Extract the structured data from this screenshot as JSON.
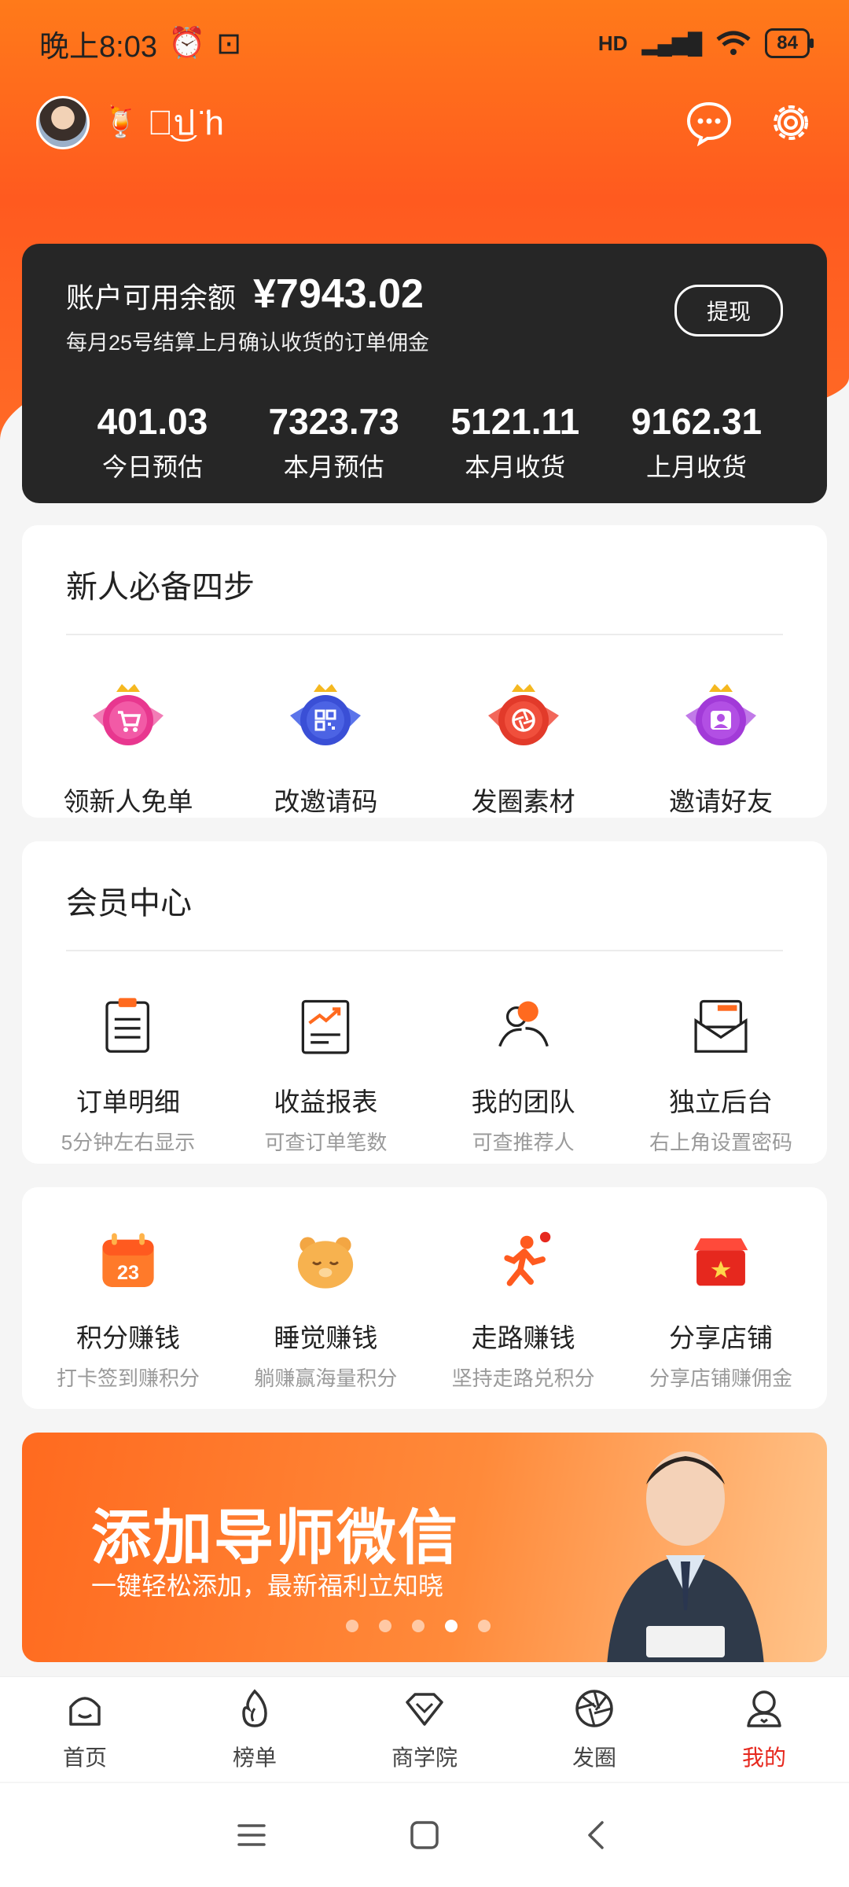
{
  "status": {
    "time": "晚上8:03",
    "network": "HD",
    "battery": "84"
  },
  "profile": {
    "name": "ป͜ป ̈h",
    "drink_emoji": "🍹"
  },
  "balance": {
    "label": "账户可用余额",
    "amount": "¥7943.02",
    "note": "每月25号结算上月确认收货的订单佣金",
    "withdraw_label": "提现",
    "stats": [
      {
        "value": "401.03",
        "label": "今日预估"
      },
      {
        "value": "7323.73",
        "label": "本月预估"
      },
      {
        "value": "5121.11",
        "label": "本月收货"
      },
      {
        "value": "9162.31",
        "label": "上月收货"
      }
    ]
  },
  "newbie": {
    "title": "新人必备四步",
    "items": [
      {
        "label": "领新人免单",
        "icon": "cart-badge-icon",
        "color": "#e8378f"
      },
      {
        "label": "改邀请码",
        "icon": "qrcode-badge-icon",
        "color": "#3a4fd6"
      },
      {
        "label": "发圈素材",
        "icon": "aperture-badge-icon",
        "color": "#e23a2a"
      },
      {
        "label": "邀请好友",
        "icon": "person-badge-icon",
        "color": "#a23ad8"
      }
    ]
  },
  "member": {
    "title": "会员中心",
    "items": [
      {
        "label": "订单明细",
        "sub": "5分钟左右显示",
        "icon": "clipboard-icon"
      },
      {
        "label": "收益报表",
        "sub": "可查订单笔数",
        "icon": "report-chart-icon"
      },
      {
        "label": "我的团队",
        "sub": "可查推荐人",
        "icon": "team-icon"
      },
      {
        "label": "独立后台",
        "sub": "右上角设置密码",
        "icon": "mail-icon"
      }
    ]
  },
  "earn": {
    "items": [
      {
        "label": "积分赚钱",
        "sub": "打卡签到赚积分",
        "icon": "calendar-icon",
        "badge": "23"
      },
      {
        "label": "睡觉赚钱",
        "sub": "躺赚赢海量积分",
        "icon": "sleeping-bear-icon"
      },
      {
        "label": "走路赚钱",
        "sub": "坚持走路兑积分",
        "icon": "running-man-icon"
      },
      {
        "label": "分享店铺",
        "sub": "分享店铺赚佣金",
        "icon": "shop-icon"
      }
    ]
  },
  "banner": {
    "title": "添加导师微信",
    "subtitle": "一键轻松添加，最新福利立知晓",
    "slide_count": 5,
    "active_slide": 4
  },
  "tabs": [
    {
      "label": "首页",
      "icon": "home-icon"
    },
    {
      "label": "榜单",
      "icon": "flame-icon"
    },
    {
      "label": "商学院",
      "icon": "diamond-icon"
    },
    {
      "label": "发圈",
      "icon": "aperture-icon"
    },
    {
      "label": "我的",
      "icon": "profile-icon",
      "active": true
    }
  ],
  "colors": {
    "brand": "#ff6a1f",
    "active_tab": "#e6281e",
    "card_dark": "#262626"
  }
}
